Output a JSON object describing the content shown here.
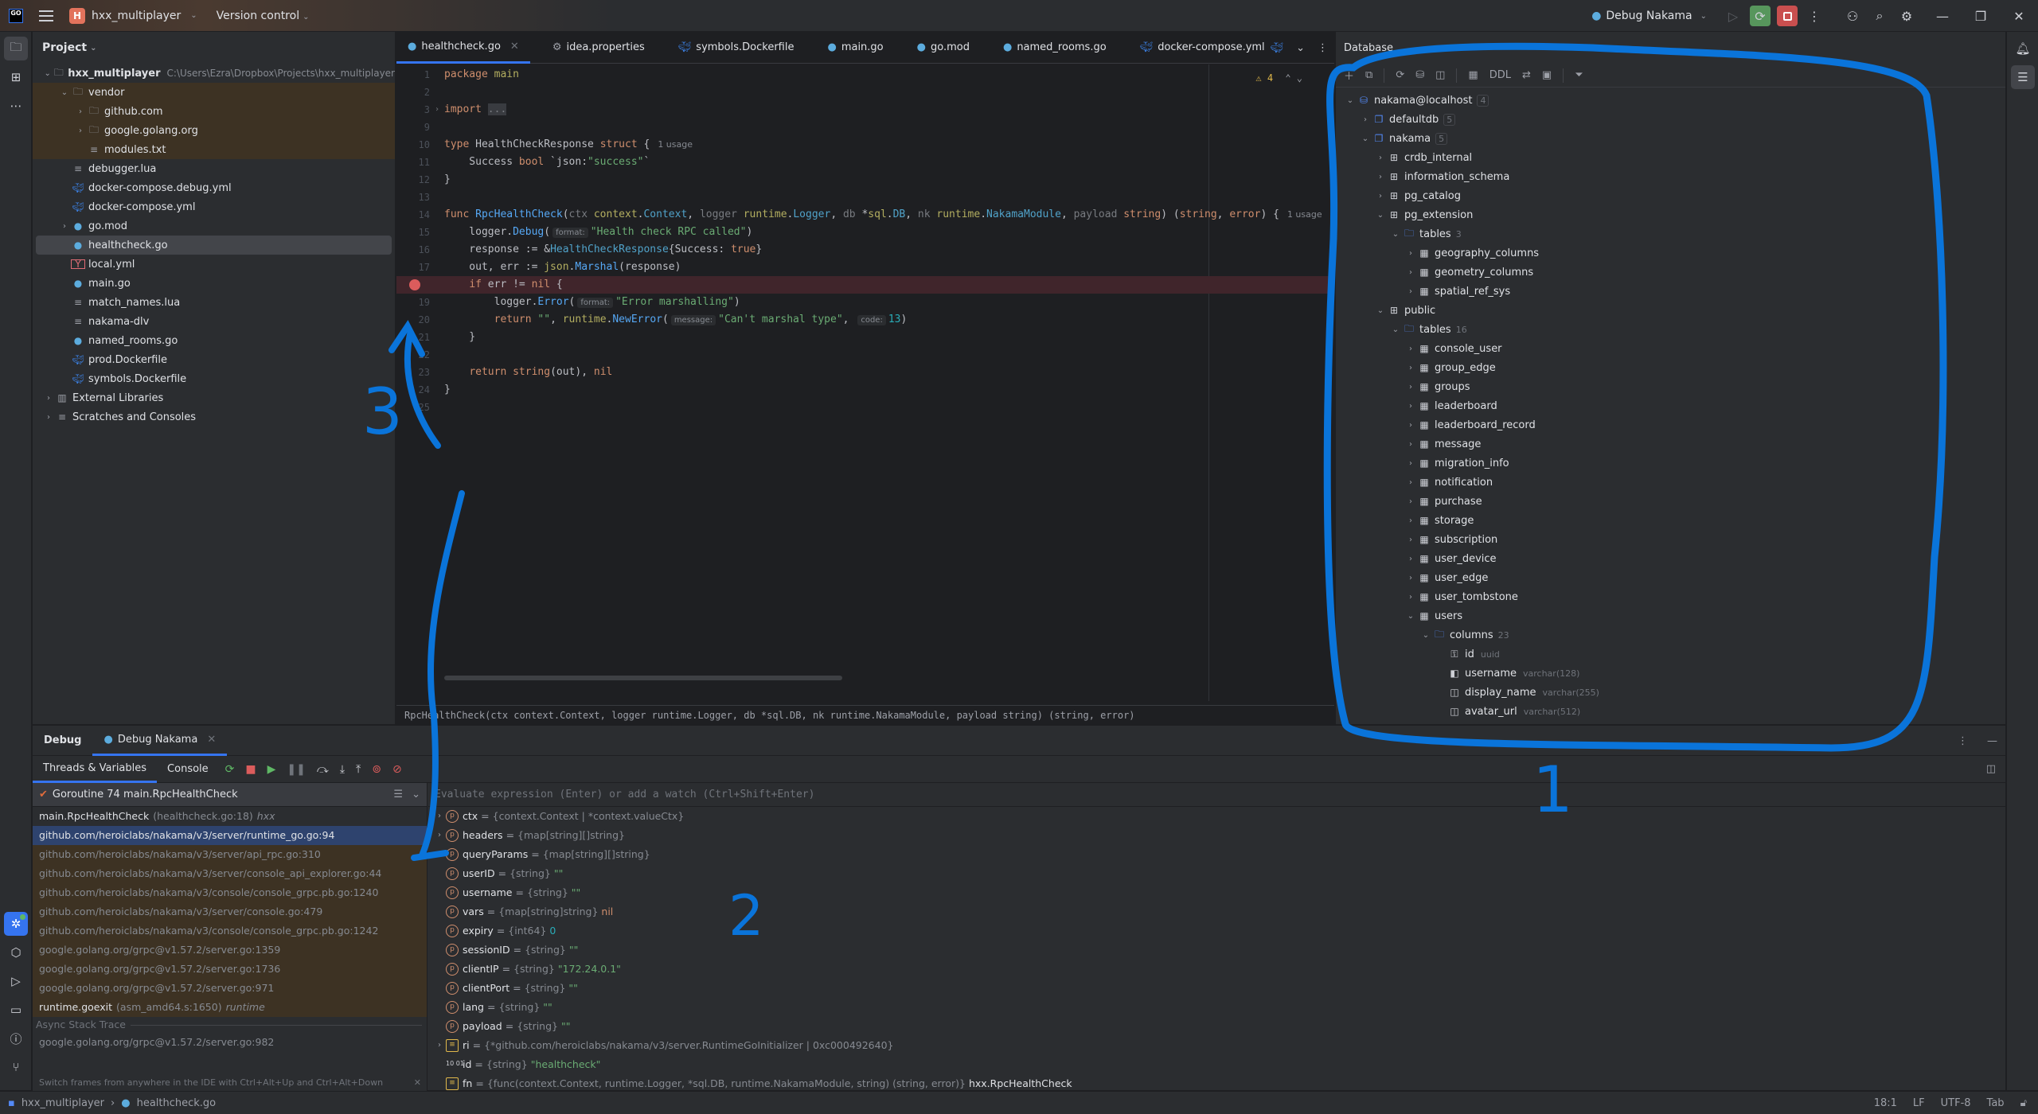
{
  "titlebar": {
    "logo": "GO",
    "project_initial": "H",
    "project_name": "hxx_multiplayer",
    "version_control": "Version control",
    "run_config": "Debug Nakama"
  },
  "project_panel": {
    "title": "Project",
    "root": {
      "name": "hxx_multiplayer",
      "path": "C:\\Users\\Ezra\\Dropbox\\Projects\\hxx_multiplayer"
    },
    "items": [
      {
        "name": "vendor",
        "type": "vendor-folder",
        "indent": 1,
        "arrow": "down",
        "vendor": true
      },
      {
        "name": "github.com",
        "type": "folder",
        "indent": 2,
        "arrow": "right",
        "vendor": true
      },
      {
        "name": "google.golang.org",
        "type": "folder",
        "indent": 2,
        "arrow": "right",
        "vendor": true
      },
      {
        "name": "modules.txt",
        "type": "text",
        "indent": 2,
        "arrow": "",
        "vendor": true
      },
      {
        "name": "debugger.lua",
        "type": "text",
        "indent": 1,
        "arrow": ""
      },
      {
        "name": "docker-compose.debug.yml",
        "type": "docker",
        "indent": 1,
        "arrow": ""
      },
      {
        "name": "docker-compose.yml",
        "type": "docker",
        "indent": 1,
        "arrow": ""
      },
      {
        "name": "go.mod",
        "type": "gomod",
        "indent": 1,
        "arrow": "right"
      },
      {
        "name": "healthcheck.go",
        "type": "go",
        "indent": 1,
        "arrow": "",
        "selected": true
      },
      {
        "name": "local.yml",
        "type": "yml",
        "indent": 1,
        "arrow": ""
      },
      {
        "name": "main.go",
        "type": "go",
        "indent": 1,
        "arrow": ""
      },
      {
        "name": "match_names.lua",
        "type": "text",
        "indent": 1,
        "arrow": ""
      },
      {
        "name": "nakama-dlv",
        "type": "text",
        "indent": 1,
        "arrow": ""
      },
      {
        "name": "named_rooms.go",
        "type": "go",
        "indent": 1,
        "arrow": ""
      },
      {
        "name": "prod.Dockerfile",
        "type": "docker",
        "indent": 1,
        "arrow": ""
      },
      {
        "name": "symbols.Dockerfile",
        "type": "docker",
        "indent": 1,
        "arrow": ""
      },
      {
        "name": "External Libraries",
        "type": "libs",
        "indent": 0,
        "arrow": "right"
      },
      {
        "name": "Scratches and Consoles",
        "type": "scratches",
        "indent": 0,
        "arrow": "right"
      }
    ]
  },
  "editor": {
    "tabs": [
      {
        "label": "healthcheck.go",
        "icon": "go",
        "active": true
      },
      {
        "label": "idea.properties",
        "icon": "gear"
      },
      {
        "label": "symbols.Dockerfile",
        "icon": "docker"
      },
      {
        "label": "main.go",
        "icon": "go"
      },
      {
        "label": "go.mod",
        "icon": "gomod"
      },
      {
        "label": "named_rooms.go",
        "icon": "go"
      },
      {
        "label": "docker-compose.yml",
        "icon": "docker"
      }
    ],
    "warnings_count": "4",
    "breakpoint_line": "18",
    "signature_breadcrumb": "RpcHealthCheck(ctx context.Context, logger runtime.Logger, db *sql.DB, nk runtime.NakamaModule, payload string) (string, error)",
    "lines": [
      {
        "n": "1",
        "html": "<span class='kw'>package</span> <span class='pkg'>main</span>"
      },
      {
        "n": "2",
        "html": ""
      },
      {
        "n": "3",
        "fold": true,
        "html": "<span class='kw'>import</span> <span class='par' style='background:#393b40'>...</span>"
      },
      {
        "n": "9",
        "html": ""
      },
      {
        "n": "10",
        "html": "<span class='kw'>type</span> HealthCheckResponse <span class='kw'>struct</span> {<span class='usage'>1 usage</span>"
      },
      {
        "n": "11",
        "html": "    Success <span class='kw'>bool</span> `json:<span class='str'>\"success\"</span>`"
      },
      {
        "n": "12",
        "html": "}"
      },
      {
        "n": "13",
        "html": ""
      },
      {
        "n": "14",
        "html": "<span class='kw'>func</span> <span class='fn'>RpcHealthCheck</span>(<span class='par'>ctx</span> <span class='pkg'>context</span>.<span class='type2'>Context</span>, <span class='par'>logger</span> <span class='pkg'>runtime</span>.<span class='type2'>Logger</span>, <span class='par'>db</span> *<span class='pkg'>sql</span>.<span class='type2'>DB</span>, <span class='par'>nk</span> <span class='pkg'>runtime</span>.<span class='type2'>NakamaModule</span>, <span class='par'>payload</span> <span class='kw'>string</span>) (<span class='kw'>string</span>, <span class='kw'>error</span>) {<span class='usage'>1 usage</span>"
      },
      {
        "n": "15",
        "html": "    logger.<span class='fn'>Debug</span>(<span class='hint'>format:</span><span class='str'>\"Health check RPC called\"</span>)"
      },
      {
        "n": "16",
        "html": "    response := &amp;<span class='type2'>HealthCheckResponse</span>{Success: <span class='kw'>true</span>}"
      },
      {
        "n": "17",
        "html": "    out, err := <span class='pkg'>json</span>.<span class='fn'>Marshal</span>(response)"
      },
      {
        "n": "18",
        "bp": true,
        "html": "    <span class='kw'>if</span> err != <span class='kw'>nil</span> {"
      },
      {
        "n": "19",
        "html": "        logger.<span class='fn'>Error</span>(<span class='hint'>format:</span><span class='str'>\"Error marshalling\"</span>)"
      },
      {
        "n": "20",
        "html": "        <span class='kw'>return</span> <span class='str'>\"\"</span>, <span class='pkg'>runtime</span>.<span class='fn'>NewError</span>(<span class='hint'>message:</span><span class='str'>\"Can't marshal type\"</span>, <span class='hint'>code:</span><span class='num'>13</span>)"
      },
      {
        "n": "21",
        "html": "    }"
      },
      {
        "n": "22",
        "html": ""
      },
      {
        "n": "23",
        "html": "    <span class='kw'>return</span> <span class='kw'>string</span>(out), <span class='kw'>nil</span>"
      },
      {
        "n": "24",
        "html": "}"
      },
      {
        "n": "25",
        "html": ""
      }
    ]
  },
  "database": {
    "title": "Database",
    "toolbar": [
      "+",
      "copy",
      "refresh",
      "db-settings",
      "jump-console",
      "table",
      "DDL",
      "diff",
      "console",
      "filter"
    ],
    "ddl_label": "DDL",
    "tree": [
      {
        "label": "nakama@localhost",
        "icon": "datasource",
        "indent": 0,
        "arrow": "down",
        "count": "4",
        "boxed": true
      },
      {
        "label": "defaultdb",
        "icon": "database",
        "indent": 1,
        "arrow": "right",
        "count": "5",
        "boxed": true
      },
      {
        "label": "nakama",
        "icon": "database",
        "indent": 1,
        "arrow": "down",
        "count": "5",
        "boxed": true
      },
      {
        "label": "crdb_internal",
        "icon": "schema",
        "indent": 2,
        "arrow": "right"
      },
      {
        "label": "information_schema",
        "icon": "schema",
        "indent": 2,
        "arrow": "right"
      },
      {
        "label": "pg_catalog",
        "icon": "schema",
        "indent": 2,
        "arrow": "right"
      },
      {
        "label": "pg_extension",
        "icon": "schema",
        "indent": 2,
        "arrow": "down"
      },
      {
        "label": "tables",
        "icon": "folder",
        "indent": 3,
        "arrow": "down",
        "count": "3"
      },
      {
        "label": "geography_columns",
        "icon": "table",
        "indent": 4,
        "arrow": "right"
      },
      {
        "label": "geometry_columns",
        "icon": "table",
        "indent": 4,
        "arrow": "right"
      },
      {
        "label": "spatial_ref_sys",
        "icon": "table",
        "indent": 4,
        "arrow": "right"
      },
      {
        "label": "public",
        "icon": "schema",
        "indent": 2,
        "arrow": "down"
      },
      {
        "label": "tables",
        "icon": "folder",
        "indent": 3,
        "arrow": "down",
        "count": "16"
      },
      {
        "label": "console_user",
        "icon": "table",
        "indent": 4,
        "arrow": "right"
      },
      {
        "label": "group_edge",
        "icon": "table",
        "indent": 4,
        "arrow": "right"
      },
      {
        "label": "groups",
        "icon": "table",
        "indent": 4,
        "arrow": "right"
      },
      {
        "label": "leaderboard",
        "icon": "table",
        "indent": 4,
        "arrow": "right"
      },
      {
        "label": "leaderboard_record",
        "icon": "table",
        "indent": 4,
        "arrow": "right"
      },
      {
        "label": "message",
        "icon": "table",
        "indent": 4,
        "arrow": "right"
      },
      {
        "label": "migration_info",
        "icon": "table",
        "indent": 4,
        "arrow": "right"
      },
      {
        "label": "notification",
        "icon": "table",
        "indent": 4,
        "arrow": "right"
      },
      {
        "label": "purchase",
        "icon": "table",
        "indent": 4,
        "arrow": "right"
      },
      {
        "label": "storage",
        "icon": "table",
        "indent": 4,
        "arrow": "right"
      },
      {
        "label": "subscription",
        "icon": "table",
        "indent": 4,
        "arrow": "right"
      },
      {
        "label": "user_device",
        "icon": "table",
        "indent": 4,
        "arrow": "right"
      },
      {
        "label": "user_edge",
        "icon": "table",
        "indent": 4,
        "arrow": "right"
      },
      {
        "label": "user_tombstone",
        "icon": "table",
        "indent": 4,
        "arrow": "right"
      },
      {
        "label": "users",
        "icon": "table",
        "indent": 4,
        "arrow": "down"
      },
      {
        "label": "columns",
        "icon": "folder",
        "indent": 5,
        "arrow": "down",
        "count": "23"
      },
      {
        "label": "id",
        "icon": "pk-column",
        "indent": 6,
        "arrow": "",
        "type": "uuid"
      },
      {
        "label": "username",
        "icon": "index-column",
        "indent": 6,
        "arrow": "",
        "type": "varchar(128)"
      },
      {
        "label": "display_name",
        "icon": "column",
        "indent": 6,
        "arrow": "",
        "type": "varchar(255)"
      },
      {
        "label": "avatar_url",
        "icon": "column",
        "indent": 6,
        "arrow": "",
        "type": "varchar(512)"
      }
    ]
  },
  "debug_panel": {
    "title": "Debug",
    "session_tab": "Debug Nakama",
    "sub_tabs": [
      "Threads & Variables",
      "Console"
    ],
    "goroutine": "Goroutine 74 main.RpcHealthCheck",
    "frames": [
      {
        "main": "main.RpcHealthCheck",
        "loc": "(healthcheck.go:18)",
        "pkg": "hxx",
        "kind": "user"
      },
      {
        "main": "github.com/heroiclabs/nakama/v3/server/runtime_go.go:94",
        "kind": "selected"
      },
      {
        "main": "github.com/heroiclabs/nakama/v3/server/api_rpc.go:310",
        "kind": "lib"
      },
      {
        "main": "github.com/heroiclabs/nakama/v3/server/console_api_explorer.go:44",
        "kind": "lib"
      },
      {
        "main": "github.com/heroiclabs/nakama/v3/console/console_grpc.pb.go:1240",
        "kind": "lib"
      },
      {
        "main": "github.com/heroiclabs/nakama/v3/server/console.go:479",
        "kind": "lib"
      },
      {
        "main": "github.com/heroiclabs/nakama/v3/console/console_grpc.pb.go:1242",
        "kind": "lib"
      },
      {
        "main": "google.golang.org/grpc@v1.57.2/server.go:1359",
        "kind": "lib"
      },
      {
        "main": "google.golang.org/grpc@v1.57.2/server.go:1736",
        "kind": "lib"
      },
      {
        "main": "google.golang.org/grpc@v1.57.2/server.go:971",
        "kind": "lib"
      },
      {
        "main": "runtime.goexit",
        "loc": "(asm_amd64.s:1650)",
        "pkg": "runtime",
        "kind": "lib-user"
      }
    ],
    "async_label": "Async Stack Trace",
    "async_frames": [
      "google.golang.org/grpc@v1.57.2/server.go:982"
    ],
    "tip": "Switch frames from anywhere in the IDE with Ctrl+Alt+Up and Ctrl+Alt+Down",
    "eval_placeholder": "Evaluate expression (Enter) or add a watch (Ctrl+Shift+Enter)",
    "variables": [
      {
        "name": "ctx",
        "type": "{context.Context | *context.valueCtx}",
        "value": "",
        "icon": "param",
        "expandable": true
      },
      {
        "name": "headers",
        "type": "{map[string][]string}",
        "value": "",
        "icon": "param",
        "expandable": true
      },
      {
        "name": "queryParams",
        "type": "{map[string][]string}",
        "value": "",
        "icon": "param"
      },
      {
        "name": "userID",
        "type": "{string}",
        "value": "\"\"",
        "vclass": "s",
        "icon": "param"
      },
      {
        "name": "username",
        "type": "{string}",
        "value": "\"\"",
        "vclass": "s",
        "icon": "param"
      },
      {
        "name": "vars",
        "type": "{map[string]string}",
        "value": "nil",
        "vclass": "k",
        "icon": "param"
      },
      {
        "name": "expiry",
        "type": "{int64}",
        "value": "0",
        "vclass": "n",
        "icon": "param"
      },
      {
        "name": "sessionID",
        "type": "{string}",
        "value": "\"\"",
        "vclass": "s",
        "icon": "param"
      },
      {
        "name": "clientIP",
        "type": "{string}",
        "value": "\"172.24.0.1\"",
        "vclass": "s",
        "icon": "param"
      },
      {
        "name": "clientPort",
        "type": "{string}",
        "value": "\"\"",
        "vclass": "s",
        "icon": "param"
      },
      {
        "name": "lang",
        "type": "{string}",
        "value": "\"\"",
        "vclass": "s",
        "icon": "param"
      },
      {
        "name": "payload",
        "type": "{string}",
        "value": "\"\"",
        "vclass": "s",
        "icon": "param"
      },
      {
        "name": "ri",
        "type": "{*github.com/heroiclabs/nakama/v3/server.RuntimeGoInitializer | 0xc000492640}",
        "value": "",
        "icon": "field",
        "expandable": true
      },
      {
        "name": "id",
        "type": "{string}",
        "value": "\"healthcheck\"",
        "vclass": "s",
        "icon": "const"
      },
      {
        "name": "fn",
        "type": "{func(context.Context, runtime.Logger, *sql.DB, runtime.NakamaModule, string) (string, error)}",
        "value": "hxx.RpcHealthCheck",
        "vclass": "w",
        "icon": "field"
      }
    ]
  },
  "statusbar": {
    "project": "hxx_multiplayer",
    "file": "healthcheck.go",
    "position": "18:1",
    "line_sep": "LF",
    "encoding": "UTF-8",
    "indent": "Tab"
  },
  "annotations": {
    "color": "#0a74da",
    "labels": [
      "1",
      "2",
      "3"
    ]
  }
}
